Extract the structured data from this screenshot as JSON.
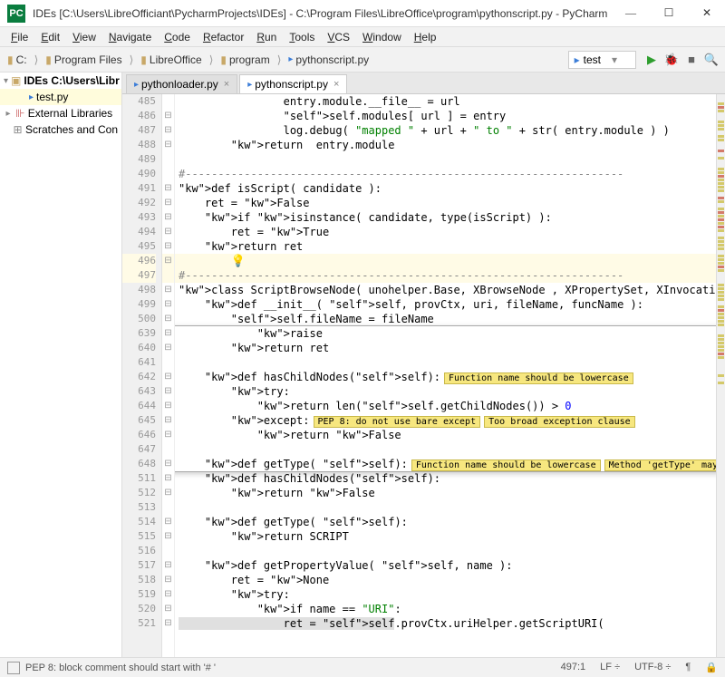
{
  "title": "IDEs [C:\\Users\\LibreOfficiant\\PycharmProjects\\IDEs] - C:\\Program Files\\LibreOffice\\program\\pythonscript.py - PyCharm",
  "menu": [
    "File",
    "Edit",
    "View",
    "Navigate",
    "Code",
    "Refactor",
    "Run",
    "Tools",
    "VCS",
    "Window",
    "Help"
  ],
  "breadcrumb": [
    "C:",
    "Program Files",
    "LibreOffice",
    "program",
    "pythonscript.py"
  ],
  "run_config": "test",
  "sidebar": {
    "root": "IDEs  C:\\Users\\Libr",
    "file": "test.py",
    "ext_lib": "External Libraries",
    "scratch": "Scratches and Con"
  },
  "tabs": [
    {
      "label": "pythonloader.py",
      "active": false
    },
    {
      "label": "pythonscript.py",
      "active": true
    }
  ],
  "code_main": [
    {
      "n": 485,
      "t": "                entry.module.__file__ = url"
    },
    {
      "n": 486,
      "t": "                self.modules[ url ] = entry"
    },
    {
      "n": 487,
      "t": "                log.debug( \"mapped \" + url + \" to \" + str( entry.module ) )"
    },
    {
      "n": 488,
      "t": "        return  entry.module"
    },
    {
      "n": 489,
      "t": ""
    },
    {
      "n": 490,
      "t": "#-------------------------------------------------------------------"
    },
    {
      "n": 491,
      "t": "def isScript( candidate ):"
    },
    {
      "n": 492,
      "t": "    ret = False"
    },
    {
      "n": 493,
      "t": "    if isinstance( candidate, type(isScript) ):"
    },
    {
      "n": 494,
      "t": "        ret = True"
    },
    {
      "n": 495,
      "t": "    return ret"
    },
    {
      "n": 496,
      "t": ""
    },
    {
      "n": 497,
      "t": "#-------------------------------------------------------------------"
    },
    {
      "n": 498,
      "t": "class ScriptBrowseNode( unohelper.Base, XBrowseNode , XPropertySet, XInvocation, XAct"
    },
    {
      "n": 499,
      "t": "    def __init__( self, provCtx, uri, fileName, funcName ):"
    },
    {
      "n": 500,
      "t": "        self.fileName = fileName"
    }
  ],
  "code_popup": [
    {
      "n": 639,
      "t": "            raise"
    },
    {
      "n": 640,
      "t": "        return ret"
    },
    {
      "n": 641,
      "t": ""
    },
    {
      "n": 642,
      "t": "    def hasChildNodes(self):",
      "hints": [
        "Function name should be lowercase"
      ]
    },
    {
      "n": 643,
      "t": "        try:"
    },
    {
      "n": 644,
      "t": "            return len(self.getChildNodes()) > 0"
    },
    {
      "n": 645,
      "t": "        except:",
      "hints": [
        "PEP 8: do not use bare except",
        "Too broad exception clause"
      ]
    },
    {
      "n": 646,
      "t": "            return False"
    },
    {
      "n": 647,
      "t": ""
    },
    {
      "n": 648,
      "t": "    def getType( self):",
      "hints": [
        "Function name should be lowercase",
        "Method 'getType' may be 'static'"
      ]
    }
  ],
  "code_below": [
    {
      "n": 511,
      "t": "    def hasChildNodes(self):"
    },
    {
      "n": 512,
      "t": "        return False"
    },
    {
      "n": 513,
      "t": ""
    },
    {
      "n": 514,
      "t": "    def getType( self):"
    },
    {
      "n": 515,
      "t": "        return SCRIPT"
    },
    {
      "n": 516,
      "t": ""
    },
    {
      "n": 517,
      "t": "    def getPropertyValue( self, name ):"
    },
    {
      "n": 518,
      "t": "        ret = None"
    },
    {
      "n": 519,
      "t": "        try:"
    },
    {
      "n": 520,
      "t": "            if name == \"URI\":"
    },
    {
      "n": 521,
      "t": "                ret = self.provCtx.uriHelper.getScriptURI("
    }
  ],
  "status": {
    "msg": "PEP 8: block comment should start with '# '",
    "pos": "497:1",
    "le": "LF",
    "enc": "UTF-8"
  }
}
